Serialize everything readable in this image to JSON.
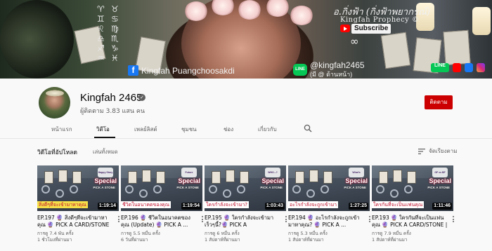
{
  "banner": {
    "zodiac": [
      "♈",
      "♉",
      "♊",
      "♋",
      "♌",
      "♍",
      "♎",
      "♏",
      "♐",
      "♑",
      "♒",
      "♓"
    ],
    "title": "อ.กิ่งฟ้า (กิ่งฟ้าพยากรณ์)",
    "subtitle": "Kingfah Prophecy ©",
    "subscribe_label": "Subscribe",
    "facebook_name": "Kingfah Puangchoosakdi",
    "line_id": "@kingfah2465",
    "line_note": "(มี @ ด้านหน้า)",
    "socials": [
      "LINE",
      "",
      "",
      ""
    ]
  },
  "channel": {
    "name": "Kingfah 2465",
    "subscribers": "ผู้ติดตาม 3.83 แสน คน",
    "subscribe_button": "ติดตาม"
  },
  "tabs": [
    {
      "label": "หน้าแรก",
      "active": false
    },
    {
      "label": "วิดีโอ",
      "active": true
    },
    {
      "label": "เพลย์ลิสต์",
      "active": false
    },
    {
      "label": "ชุมชน",
      "active": false
    },
    {
      "label": "ช่อง",
      "active": false
    },
    {
      "label": "เกี่ยวกับ",
      "active": false
    }
  ],
  "section": {
    "title": "วิดีโอที่อัปโหลด",
    "play_all": "เล่นทั้งหมด",
    "sort_label": "จัดเรียงตาม"
  },
  "videos": [
    {
      "title": "EP.197 🔮 สิ่งดีๆที่จะเข้ามาหาคุณ 🔮 PICK A CARD/STONE ...",
      "views": "การดู 7.4 พัน ครั้ง",
      "age": "1 ชั่วโมงที่ผ่านมา",
      "duration": "1:19:14",
      "caption": "สิ่งดีๆที่จะเข้ามาหาคุณ",
      "badge": "Happy Story",
      "special": "Special",
      "pick": "PICK A STONE"
    },
    {
      "title": "EP.196 🔮 ชีวิตในอนาคตของคุณ (Update) 🔮 PICK A ...",
      "views": "การดู 5.5 หมื่น ครั้ง",
      "age": "6 วันที่ผ่านมา",
      "duration": "1:19:54",
      "caption": "ชีวิตในอนาคตของคุณ",
      "badge": "Future",
      "special": "Special",
      "pick": "PICK A STONE"
    },
    {
      "title": "EP.195 🔮 ใครกำลังจะเข้ามาเร็วๆนี้?🔮 PICK A CARD/STONE | ...",
      "views": "การดู 6 หมื่น ครั้ง",
      "age": "1 สัปดาห์ที่ผ่านมา",
      "duration": "1:03:43",
      "caption": "ใครกำลังจะเข้ามา?",
      "badge": "WHO...?",
      "special": "Special",
      "pick": "PICK A STONE"
    },
    {
      "title": "EP.194 🔮 อะไรกำลังจะถูกเข้ามาหาคุณ? 🔮 PICK A ...",
      "views": "การดู 5.3 หมื่น ครั้ง",
      "age": "1 สัปดาห์ที่ผ่านมา",
      "duration": "1:27:25",
      "caption": "อะไรกำลังจะถูกเข้ามา",
      "badge": "What's Happen?",
      "special": "Special",
      "pick": "PICK A STONE"
    },
    {
      "title": "EP.193 🔮 ใครกันที่จะเป็นแฟนคุณ 🔮 PICK A CARD/STONE | ...",
      "views": "การดู 7.9 หมื่น ครั้ง",
      "age": "1 สัปดาห์ที่ผ่านมา",
      "duration": "1:11:46",
      "caption": "ใครกันที่จะเป็นแฟนคุณ",
      "badge": "GF vs BF",
      "special": "Special",
      "pick": "PICK A STONE"
    }
  ],
  "colors": {
    "subscribe_red": "#cc0000",
    "caption_yellow": "#f5e04a",
    "caption_white": "#ffffff",
    "caption_text_red": "#c0142f"
  }
}
